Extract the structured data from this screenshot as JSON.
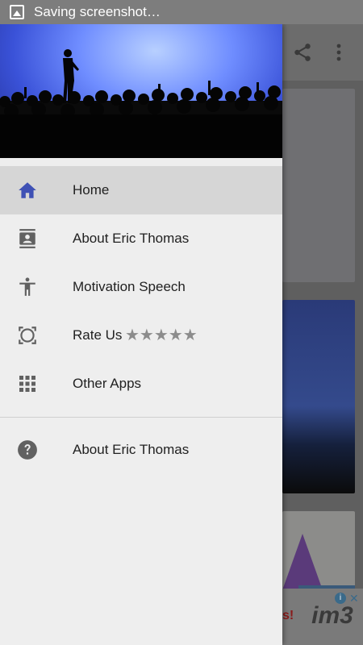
{
  "status_bar": {
    "text": "Saving screenshot…",
    "icon": "image-icon"
  },
  "toolbar": {
    "share_icon": "share-icon",
    "more_icon": "more-vert-icon"
  },
  "drawer": {
    "header_image": "speaker-on-stage-crowd",
    "items": [
      {
        "label": "Home",
        "icon": "home-icon",
        "active": true
      },
      {
        "label": "About Eric Thomas",
        "icon": "contact-card-icon",
        "active": false
      },
      {
        "label": "Motivation Speech",
        "icon": "accessibility-icon",
        "active": false
      },
      {
        "label": "Rate Us",
        "icon": "rate-icon",
        "stars": "★★★★★",
        "active": false
      },
      {
        "label": "Other Apps",
        "icon": "apps-grid-icon",
        "active": false
      }
    ],
    "secondary_items": [
      {
        "label": "About Eric Thomas",
        "icon": "help-icon"
      }
    ]
  },
  "ad": {
    "text": "s!",
    "logo": "im3"
  },
  "colors": {
    "accent": "#3f51b5",
    "icon_gray": "#616161",
    "drawer_bg": "#eeeeee",
    "active_bg": "#d6d6d6"
  }
}
